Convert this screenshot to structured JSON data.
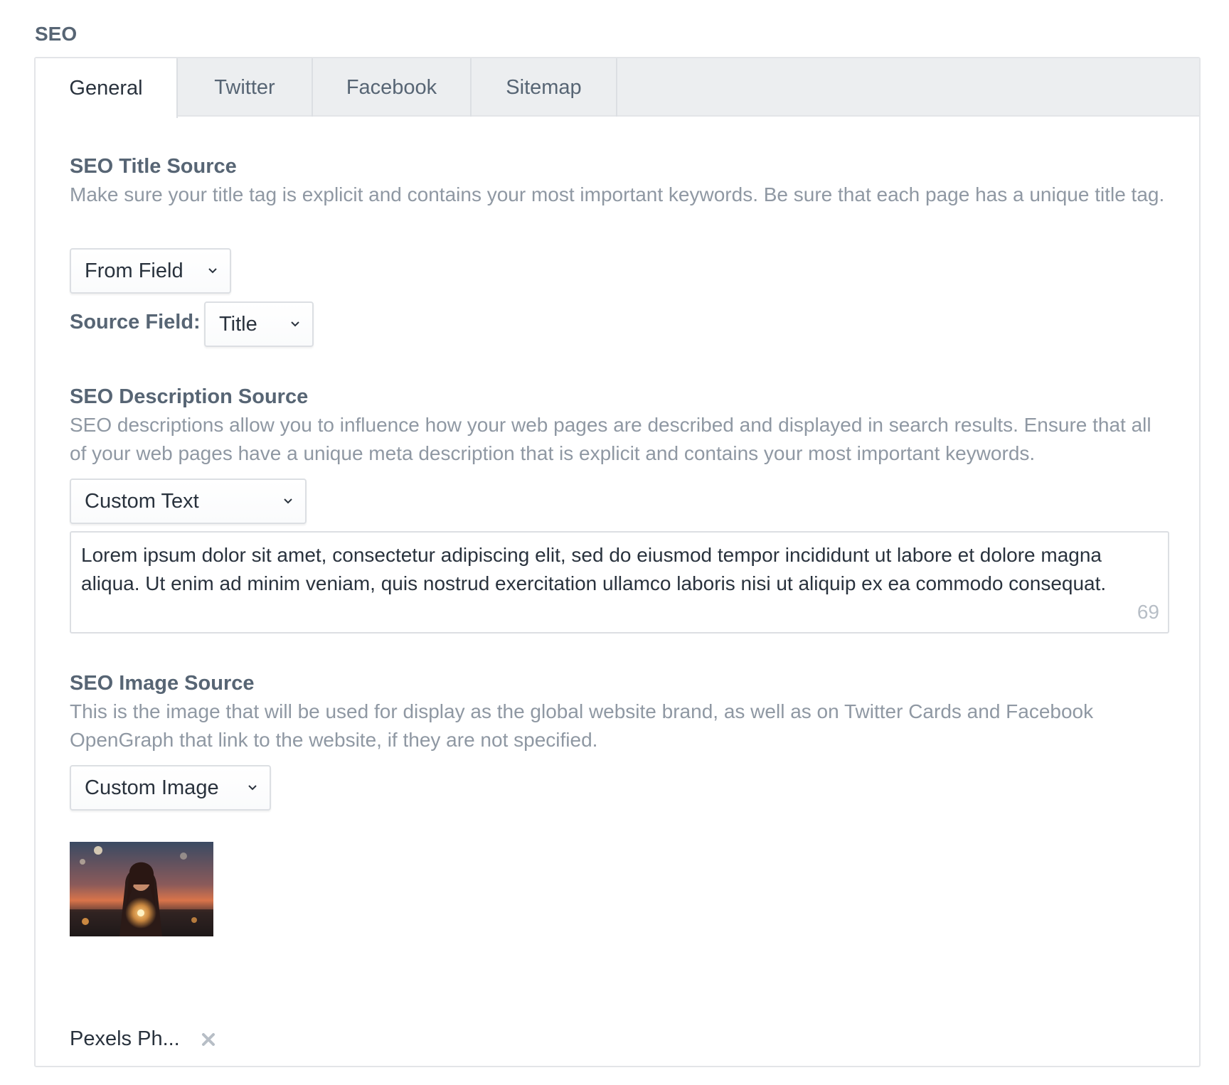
{
  "field": {
    "heading": "SEO"
  },
  "tabs": [
    {
      "label": "General",
      "active": true
    },
    {
      "label": "Twitter",
      "active": false
    },
    {
      "label": "Facebook",
      "active": false
    },
    {
      "label": "Sitemap",
      "active": false
    }
  ],
  "title_source": {
    "heading": "SEO Title Source",
    "instructions": "Make sure your title tag is explicit and contains your most important keywords. Be sure that each page has a unique title tag.",
    "source_select": "From Field",
    "source_field_label": "Source Field:",
    "source_field_select": "Title"
  },
  "description_source": {
    "heading": "SEO Description Source",
    "instructions": "SEO descriptions allow you to influence how your web pages are described and displayed in search results. Ensure that all of your web pages have a unique meta description that is explicit and contains your most important keywords.",
    "source_select": "Custom Text",
    "text": "Lorem ipsum dolor sit amet, consectetur adipiscing elit, sed do eiusmod tempor incididunt ut labore et dolore magna aliqua. Ut enim ad minim veniam, quis nostrud exercitation ullamco laboris nisi ut aliquip ex ea commodo consequat.",
    "char_count": "69"
  },
  "image_source": {
    "heading": "SEO Image Source",
    "instructions": "This is the image that will be used for display as the global website brand, as well as on Twitter Cards and Facebook OpenGraph that link to the website, if they are not specified.",
    "source_select": "Custom Image",
    "asset_title": "Pexels Ph..."
  },
  "icons": {
    "select_arrow": "chevron-down-icon",
    "remove": "close-icon"
  }
}
